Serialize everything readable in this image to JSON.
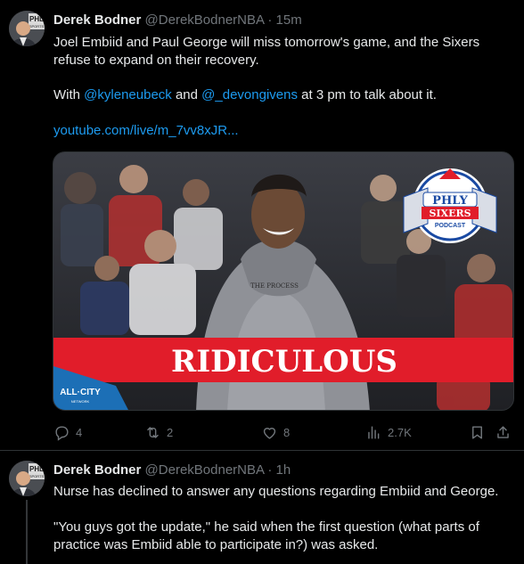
{
  "tweets": [
    {
      "author_name": "Derek Bodner",
      "handle": "@DerekBodnerNBA",
      "separator": "·",
      "time": "15m",
      "text_line1": "Joel Embiid and Paul George will miss tomorrow's game, and the Sixers",
      "text_line2": "refuse to expand on their recovery.",
      "text_with_prefix": "With ",
      "mention1": "@kyleneubeck",
      "text_and": " and ",
      "mention2": "@_devongivens",
      "text_suffix": " at 3 pm to talk about it.",
      "link": "youtube.com/live/m_7vv8xJR...",
      "media": {
        "banner_text": "RIDICULOUS",
        "badge_line1": "PHLY",
        "badge_line2": "SIXERS",
        "badge_line3": "PODCAST",
        "network_text": "ALL·CITY",
        "network_sub": "NETWORK",
        "shirt_text": "THE PROCESS"
      },
      "actions": {
        "replies": "4",
        "reposts": "2",
        "likes": "8",
        "views": "2.7K"
      }
    },
    {
      "author_name": "Derek Bodner",
      "handle": "@DerekBodnerNBA",
      "separator": "·",
      "time": "1h",
      "text1": "Nurse has declined to answer any questions regarding Embiid and George.",
      "text2_line1": "\"You guys got the update,\" he said when the first question (what parts of",
      "text2_line2": "practice was Embiid able to participate in?) was asked."
    }
  ],
  "avatar_badge_text": "PHL",
  "avatar_badge_sub": "SPORTS",
  "colors": {
    "background": "#000000",
    "text": "#e7e9ea",
    "muted": "#71767b",
    "link": "#1d9bf0",
    "banner_red": "#e11d2a",
    "badge_blue": "#1a4aa3"
  },
  "icons": [
    "reply-icon",
    "repost-icon",
    "like-icon",
    "views-icon",
    "bookmark-icon",
    "share-icon"
  ]
}
